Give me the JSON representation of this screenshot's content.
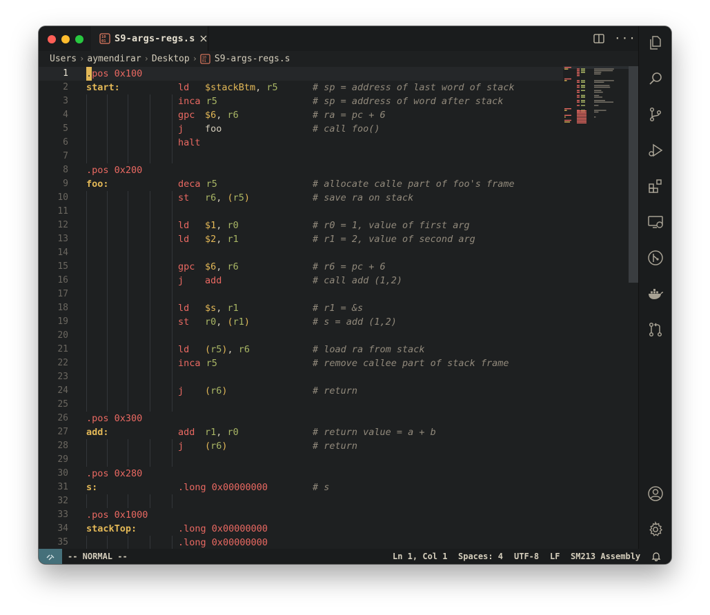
{
  "window": {
    "tab_title": "S9-args-regs.s"
  },
  "breadcrumb": [
    "Users",
    "aymendirar",
    "Desktop",
    "S9-args-regs.s"
  ],
  "editor": {
    "lines": [
      {
        "n": "1",
        "parts": [
          [
            "cursor",
            "."
          ],
          [
            "k-dir",
            "pos "
          ],
          [
            "k-num",
            "0x100"
          ]
        ]
      },
      {
        "n": "2",
        "parts": [
          [
            "k-label",
            "start:"
          ],
          [
            "pad",
            ""
          ],
          [
            "k-op",
            "ld"
          ],
          [
            "gap",
            ""
          ],
          [
            "k-sym",
            "$stackBtm"
          ],
          [
            "k-plain",
            ", "
          ],
          [
            "k-reg",
            "r5"
          ],
          [
            "cmt",
            "# sp = address of last word of stack"
          ]
        ]
      },
      {
        "n": "3",
        "parts": [
          [
            "pad",
            ""
          ],
          [
            "k-op",
            "inca"
          ],
          [
            "sp",
            " "
          ],
          [
            "k-reg",
            "r5"
          ],
          [
            "cmt",
            "# sp = address of word after stack"
          ]
        ]
      },
      {
        "n": "4",
        "parts": [
          [
            "pad",
            ""
          ],
          [
            "k-op",
            "gpc"
          ],
          [
            "gap",
            ""
          ],
          [
            "k-sym",
            "$6"
          ],
          [
            "k-plain",
            ", "
          ],
          [
            "k-reg",
            "r6"
          ],
          [
            "cmt",
            "# ra = pc + 6"
          ]
        ]
      },
      {
        "n": "5",
        "parts": [
          [
            "pad",
            ""
          ],
          [
            "k-op",
            "j"
          ],
          [
            "gap",
            ""
          ],
          [
            "k-plain",
            "foo"
          ],
          [
            "cmt",
            "# call foo()"
          ]
        ]
      },
      {
        "n": "6",
        "parts": [
          [
            "pad",
            ""
          ],
          [
            "k-op",
            "halt"
          ]
        ]
      },
      {
        "n": "7",
        "parts": []
      },
      {
        "n": "8",
        "parts": [
          [
            "k-dir",
            ".pos "
          ],
          [
            "k-num",
            "0x200"
          ]
        ]
      },
      {
        "n": "9",
        "parts": [
          [
            "k-label",
            "foo:"
          ],
          [
            "pad",
            ""
          ],
          [
            "k-op",
            "deca"
          ],
          [
            "sp",
            " "
          ],
          [
            "k-reg",
            "r5"
          ],
          [
            "cmt",
            "# allocate calle part of foo's frame"
          ]
        ]
      },
      {
        "n": "10",
        "parts": [
          [
            "pad",
            ""
          ],
          [
            "k-op",
            "st"
          ],
          [
            "gap",
            ""
          ],
          [
            "k-reg",
            "r6"
          ],
          [
            "k-plain",
            ", "
          ],
          [
            "k-paren",
            "("
          ],
          [
            "k-reg",
            "r5"
          ],
          [
            "k-paren",
            ")"
          ],
          [
            "cmt",
            "# save ra on stack"
          ]
        ]
      },
      {
        "n": "11",
        "parts": []
      },
      {
        "n": "12",
        "parts": [
          [
            "pad",
            ""
          ],
          [
            "k-op",
            "ld"
          ],
          [
            "gap",
            ""
          ],
          [
            "k-sym",
            "$1"
          ],
          [
            "k-plain",
            ", "
          ],
          [
            "k-reg",
            "r0"
          ],
          [
            "cmt",
            "# r0 = 1, value of first arg"
          ]
        ]
      },
      {
        "n": "13",
        "parts": [
          [
            "pad",
            ""
          ],
          [
            "k-op",
            "ld"
          ],
          [
            "gap",
            ""
          ],
          [
            "k-sym",
            "$2"
          ],
          [
            "k-plain",
            ", "
          ],
          [
            "k-reg",
            "r1"
          ],
          [
            "cmt",
            "# r1 = 2, value of second arg"
          ]
        ]
      },
      {
        "n": "14",
        "parts": []
      },
      {
        "n": "15",
        "parts": [
          [
            "pad",
            ""
          ],
          [
            "k-op",
            "gpc"
          ],
          [
            "gap",
            ""
          ],
          [
            "k-sym",
            "$6"
          ],
          [
            "k-plain",
            ", "
          ],
          [
            "k-reg",
            "r6"
          ],
          [
            "cmt",
            "# r6 = pc + 6"
          ]
        ]
      },
      {
        "n": "16",
        "parts": [
          [
            "pad",
            ""
          ],
          [
            "k-op",
            "j"
          ],
          [
            "gap",
            ""
          ],
          [
            "k-op",
            "add"
          ],
          [
            "cmt",
            "# call add (1,2)"
          ]
        ]
      },
      {
        "n": "17",
        "parts": []
      },
      {
        "n": "18",
        "parts": [
          [
            "pad",
            ""
          ],
          [
            "k-op",
            "ld"
          ],
          [
            "gap",
            ""
          ],
          [
            "k-sym",
            "$s"
          ],
          [
            "k-plain",
            ", "
          ],
          [
            "k-reg",
            "r1"
          ],
          [
            "cmt",
            "# r1 = &s"
          ]
        ]
      },
      {
        "n": "19",
        "parts": [
          [
            "pad",
            ""
          ],
          [
            "k-op",
            "st"
          ],
          [
            "gap",
            ""
          ],
          [
            "k-reg",
            "r0"
          ],
          [
            "k-plain",
            ", "
          ],
          [
            "k-paren",
            "("
          ],
          [
            "k-reg",
            "r1"
          ],
          [
            "k-paren",
            ")"
          ],
          [
            "cmt",
            "# s = add (1,2)"
          ]
        ]
      },
      {
        "n": "20",
        "parts": []
      },
      {
        "n": "21",
        "parts": [
          [
            "pad",
            ""
          ],
          [
            "k-op",
            "ld"
          ],
          [
            "gap",
            ""
          ],
          [
            "k-paren",
            "("
          ],
          [
            "k-reg",
            "r5"
          ],
          [
            "k-paren",
            ")"
          ],
          [
            "k-plain",
            ", "
          ],
          [
            "k-reg",
            "r6"
          ],
          [
            "cmt",
            "# load ra from stack"
          ]
        ]
      },
      {
        "n": "22",
        "parts": [
          [
            "pad",
            ""
          ],
          [
            "k-op",
            "inca"
          ],
          [
            "sp",
            " "
          ],
          [
            "k-reg",
            "r5"
          ],
          [
            "cmt",
            "# remove callee part of stack frame"
          ]
        ]
      },
      {
        "n": "23",
        "parts": []
      },
      {
        "n": "24",
        "parts": [
          [
            "pad",
            ""
          ],
          [
            "k-op",
            "j"
          ],
          [
            "gap",
            ""
          ],
          [
            "k-paren",
            "("
          ],
          [
            "k-reg",
            "r6"
          ],
          [
            "k-paren",
            ")"
          ],
          [
            "cmt",
            "# return"
          ]
        ]
      },
      {
        "n": "25",
        "parts": []
      },
      {
        "n": "26",
        "parts": [
          [
            "k-dir",
            ".pos "
          ],
          [
            "k-num",
            "0x300"
          ]
        ]
      },
      {
        "n": "27",
        "parts": [
          [
            "k-label",
            "add:"
          ],
          [
            "pad",
            ""
          ],
          [
            "k-op",
            "add"
          ],
          [
            "gap",
            ""
          ],
          [
            "k-reg",
            "r1"
          ],
          [
            "k-plain",
            ", "
          ],
          [
            "k-reg",
            "r0"
          ],
          [
            "cmt",
            "# return value = a + b"
          ]
        ]
      },
      {
        "n": "28",
        "parts": [
          [
            "pad",
            ""
          ],
          [
            "k-op",
            "j"
          ],
          [
            "gap",
            ""
          ],
          [
            "k-paren",
            "("
          ],
          [
            "k-reg",
            "r6"
          ],
          [
            "k-paren",
            ")"
          ],
          [
            "cmt",
            "# return"
          ]
        ]
      },
      {
        "n": "29",
        "parts": []
      },
      {
        "n": "30",
        "parts": [
          [
            "k-dir",
            ".pos "
          ],
          [
            "k-num",
            "0x280"
          ]
        ]
      },
      {
        "n": "31",
        "parts": [
          [
            "k-label",
            "s:"
          ],
          [
            "pad",
            ""
          ],
          [
            "k-dir",
            ".long "
          ],
          [
            "k-num",
            "0x00000000"
          ],
          [
            "cmt",
            "# s"
          ]
        ]
      },
      {
        "n": "32",
        "parts": []
      },
      {
        "n": "33",
        "parts": [
          [
            "k-dir",
            ".pos "
          ],
          [
            "k-num",
            "0x1000"
          ]
        ]
      },
      {
        "n": "34",
        "parts": [
          [
            "k-label",
            "stackTop:"
          ],
          [
            "pad",
            ""
          ],
          [
            "k-dir",
            ".long "
          ],
          [
            "k-num",
            "0x00000000"
          ]
        ]
      },
      {
        "n": "35",
        "parts": [
          [
            "pad",
            ""
          ],
          [
            "k-dir",
            ".long "
          ],
          [
            "k-num",
            "0x00000000"
          ]
        ]
      }
    ]
  },
  "statusbar": {
    "mode": "-- NORMAL --",
    "position": "Ln 1, Col 1",
    "spaces": "Spaces: 4",
    "encoding": "UTF-8",
    "eol": "LF",
    "language": "SM213 Assembly"
  },
  "icons": {
    "activity": [
      "explorer-icon",
      "search-icon",
      "source-control-icon",
      "run-debug-icon",
      "extensions-icon",
      "remote-explorer-icon",
      "git-graph-icon",
      "docker-icon",
      "pull-request-icon",
      "account-icon",
      "settings-gear-icon"
    ]
  },
  "colors": {
    "background": "#1e2021",
    "keyword": "#ea6962",
    "label": "#e3b857",
    "register": "#a9b665",
    "comment": "#928a7c",
    "remote_indicator": "#45707a"
  }
}
